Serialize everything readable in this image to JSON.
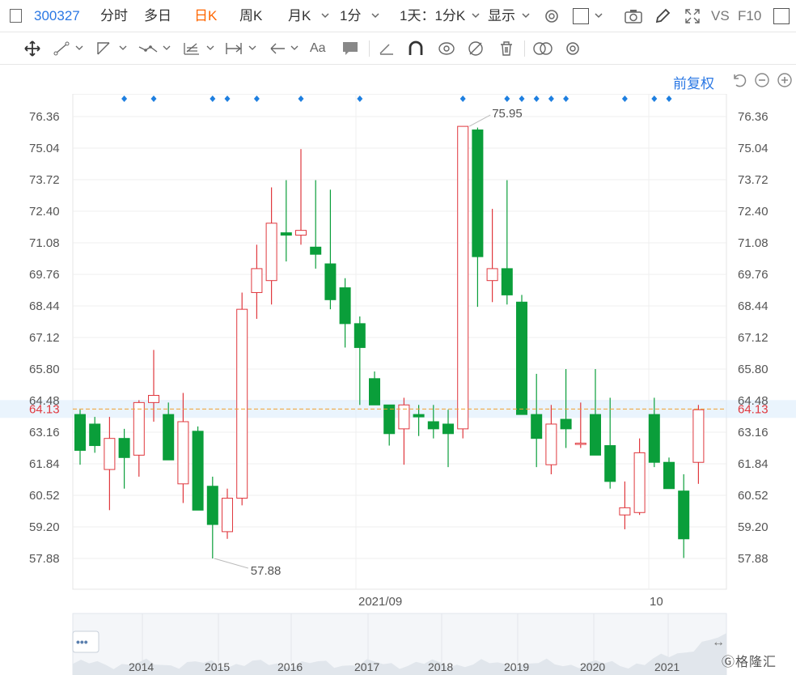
{
  "toolbar": {
    "code": "300327",
    "tabs": [
      "分时",
      "多日",
      "日K",
      "周K",
      "月K"
    ],
    "active_tab": "日K",
    "period_select": "1分",
    "multi_select": "1天：1分K",
    "display_select": "显示",
    "vs_label": "VS",
    "f10_label": "F10"
  },
  "subbar": {
    "adjust_label": "前复权"
  },
  "colors": {
    "up": "#e0383e",
    "down": "#0a9e3a",
    "price_line": "#f0a030",
    "accent": "#2b78e4",
    "price_label": "#e0383e"
  },
  "icons": [
    "square-icon",
    "gear-icon",
    "camera-icon",
    "pencil-icon",
    "expand-icon",
    "move-icon",
    "line-tool-icon",
    "polyline-tool-icon",
    "wave-tool-icon",
    "fib-tool-icon",
    "measure-tool-icon",
    "arrow-tool-icon",
    "text-tool-icon",
    "note-tool-icon",
    "eraser-icon",
    "magnet-icon",
    "link-icon",
    "hide-icon",
    "trash-icon",
    "compare-icon",
    "settings-icon",
    "undo-icon",
    "zoom-out-icon",
    "zoom-in-icon"
  ],
  "chart_data": {
    "type": "candlestick",
    "y_ticks": [
      "76.36",
      "75.04",
      "73.72",
      "72.40",
      "71.08",
      "69.76",
      "68.44",
      "67.12",
      "65.80",
      "64.48",
      "63.16",
      "61.84",
      "60.52",
      "59.20",
      "57.88"
    ],
    "ylim": [
      57.88,
      76.36
    ],
    "x_labels": [
      "2021/09",
      "10"
    ],
    "current_price": "64.13",
    "max_label": "75.95",
    "min_label": "57.88",
    "candles": [
      {
        "o": 63.9,
        "h": 64.1,
        "l": 61.8,
        "c": 62.4
      },
      {
        "o": 63.5,
        "h": 63.8,
        "l": 62.3,
        "c": 62.6
      },
      {
        "o": 61.6,
        "h": 63.8,
        "l": 59.9,
        "c": 62.9
      },
      {
        "o": 62.9,
        "h": 63.3,
        "l": 60.8,
        "c": 62.1
      },
      {
        "o": 62.2,
        "h": 64.5,
        "l": 61.3,
        "c": 64.4
      },
      {
        "o": 64.4,
        "h": 66.6,
        "l": 63.6,
        "c": 64.7
      },
      {
        "o": 63.9,
        "h": 64.4,
        "l": 62.0,
        "c": 62.0
      },
      {
        "o": 61.0,
        "h": 64.8,
        "l": 60.2,
        "c": 63.6
      },
      {
        "o": 63.2,
        "h": 63.4,
        "l": 59.9,
        "c": 59.9
      },
      {
        "o": 60.9,
        "h": 61.3,
        "l": 57.88,
        "c": 59.3
      },
      {
        "o": 59.0,
        "h": 60.8,
        "l": 58.7,
        "c": 60.4
      },
      {
        "o": 60.4,
        "h": 69.0,
        "l": 60.1,
        "c": 68.3
      },
      {
        "o": 69.0,
        "h": 71.0,
        "l": 67.9,
        "c": 70.0
      },
      {
        "o": 69.5,
        "h": 73.4,
        "l": 68.5,
        "c": 71.9
      },
      {
        "o": 71.5,
        "h": 73.7,
        "l": 70.3,
        "c": 71.4
      },
      {
        "o": 71.4,
        "h": 75.0,
        "l": 71.0,
        "c": 71.6
      },
      {
        "o": 70.9,
        "h": 73.7,
        "l": 70.0,
        "c": 70.6
      },
      {
        "o": 70.2,
        "h": 73.3,
        "l": 68.3,
        "c": 68.7
      },
      {
        "o": 69.2,
        "h": 69.6,
        "l": 66.7,
        "c": 67.7
      },
      {
        "o": 67.7,
        "h": 68.0,
        "l": 64.3,
        "c": 66.7
      },
      {
        "o": 65.4,
        "h": 65.7,
        "l": 64.4,
        "c": 64.3
      },
      {
        "o": 64.3,
        "h": 64.3,
        "l": 62.6,
        "c": 63.1
      },
      {
        "o": 63.3,
        "h": 64.6,
        "l": 61.8,
        "c": 64.3
      },
      {
        "o": 63.9,
        "h": 64.3,
        "l": 63.0,
        "c": 63.8
      },
      {
        "o": 63.6,
        "h": 64.3,
        "l": 62.9,
        "c": 63.3
      },
      {
        "o": 63.5,
        "h": 64.1,
        "l": 61.7,
        "c": 63.1
      },
      {
        "o": 63.3,
        "h": 75.95,
        "l": 62.9,
        "c": 75.95
      },
      {
        "o": 75.8,
        "h": 75.9,
        "l": 68.4,
        "c": 70.5
      },
      {
        "o": 69.5,
        "h": 72.5,
        "l": 68.6,
        "c": 70.0
      },
      {
        "o": 70.0,
        "h": 73.7,
        "l": 68.5,
        "c": 68.9
      },
      {
        "o": 68.6,
        "h": 68.9,
        "l": 63.9,
        "c": 63.9
      },
      {
        "o": 63.9,
        "h": 65.6,
        "l": 61.7,
        "c": 62.9
      },
      {
        "o": 61.8,
        "h": 64.3,
        "l": 61.4,
        "c": 63.5
      },
      {
        "o": 63.7,
        "h": 65.8,
        "l": 62.5,
        "c": 63.3
      },
      {
        "o": 62.7,
        "h": 64.4,
        "l": 62.5,
        "c": 62.7
      },
      {
        "o": 63.9,
        "h": 65.8,
        "l": 62.5,
        "c": 62.2
      },
      {
        "o": 62.6,
        "h": 64.6,
        "l": 60.8,
        "c": 61.1
      },
      {
        "o": 59.7,
        "h": 61.1,
        "l": 59.1,
        "c": 60.0
      },
      {
        "o": 59.8,
        "h": 62.9,
        "l": 59.7,
        "c": 62.3
      },
      {
        "o": 63.9,
        "h": 64.6,
        "l": 61.7,
        "c": 61.9
      },
      {
        "o": 61.9,
        "h": 62.1,
        "l": 60.9,
        "c": 60.8
      },
      {
        "o": 60.7,
        "h": 61.4,
        "l": 57.9,
        "c": 58.7
      },
      {
        "o": 61.9,
        "h": 64.3,
        "l": 61.0,
        "c": 64.1
      }
    ],
    "event_marker_indices": [
      3,
      5,
      9,
      10,
      12,
      15,
      19,
      26,
      29,
      30,
      31,
      32,
      33,
      37,
      39,
      40
    ],
    "navigator": {
      "years": [
        "2014",
        "2015",
        "2016",
        "2017",
        "2018",
        "2019",
        "2020",
        "2021"
      ],
      "button": "•••"
    }
  }
}
